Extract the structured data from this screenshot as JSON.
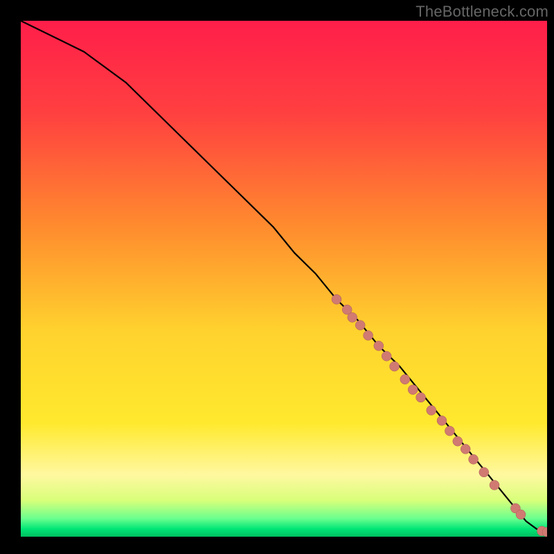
{
  "watermark": "TheBottleneck.com",
  "colors": {
    "gradient_stops": [
      {
        "offset": 0.0,
        "color": "#ff1e4a"
      },
      {
        "offset": 0.18,
        "color": "#ff4040"
      },
      {
        "offset": 0.4,
        "color": "#ff8c2e"
      },
      {
        "offset": 0.6,
        "color": "#ffd22e"
      },
      {
        "offset": 0.78,
        "color": "#ffe92e"
      },
      {
        "offset": 0.88,
        "color": "#fff8a0"
      },
      {
        "offset": 0.93,
        "color": "#d8ff7a"
      },
      {
        "offset": 0.965,
        "color": "#6aff8e"
      },
      {
        "offset": 0.985,
        "color": "#00e676"
      },
      {
        "offset": 1.0,
        "color": "#00c060"
      }
    ],
    "line": "#000000",
    "marker": "#d07a72",
    "marker_border": "#a85c55"
  },
  "chart_data": {
    "type": "line",
    "title": "",
    "xlabel": "",
    "ylabel": "",
    "xlim": [
      0,
      100
    ],
    "ylim": [
      0,
      100
    ],
    "grid": false,
    "legend": false,
    "series": [
      {
        "name": "bottleneck-curve",
        "x": [
          0,
          4,
          8,
          12,
          16,
          20,
          24,
          28,
          32,
          36,
          40,
          44,
          48,
          52,
          56,
          60,
          64,
          68,
          72,
          76,
          80,
          84,
          88,
          92,
          96,
          98,
          100
        ],
        "y": [
          100,
          98,
          96,
          94,
          91,
          88,
          84,
          80,
          76,
          72,
          68,
          64,
          60,
          55,
          51,
          46,
          42,
          37,
          33,
          28,
          23,
          18,
          13,
          8,
          3,
          1.5,
          1.2
        ]
      }
    ],
    "markers": [
      {
        "x": 60,
        "y": 46
      },
      {
        "x": 62,
        "y": 44
      },
      {
        "x": 63,
        "y": 42.5
      },
      {
        "x": 64.5,
        "y": 41
      },
      {
        "x": 66,
        "y": 39
      },
      {
        "x": 68,
        "y": 37
      },
      {
        "x": 69.5,
        "y": 35
      },
      {
        "x": 71,
        "y": 33
      },
      {
        "x": 73,
        "y": 30.5
      },
      {
        "x": 74.5,
        "y": 28.5
      },
      {
        "x": 76,
        "y": 27
      },
      {
        "x": 78,
        "y": 24.5
      },
      {
        "x": 80,
        "y": 22.5
      },
      {
        "x": 81.5,
        "y": 20.5
      },
      {
        "x": 83,
        "y": 18.5
      },
      {
        "x": 84.5,
        "y": 17
      },
      {
        "x": 86,
        "y": 15
      },
      {
        "x": 88,
        "y": 12.5
      },
      {
        "x": 90,
        "y": 10
      },
      {
        "x": 94,
        "y": 5.5
      },
      {
        "x": 95,
        "y": 4.3
      },
      {
        "x": 99,
        "y": 1.1
      },
      {
        "x": 100,
        "y": 0.9
      }
    ]
  }
}
